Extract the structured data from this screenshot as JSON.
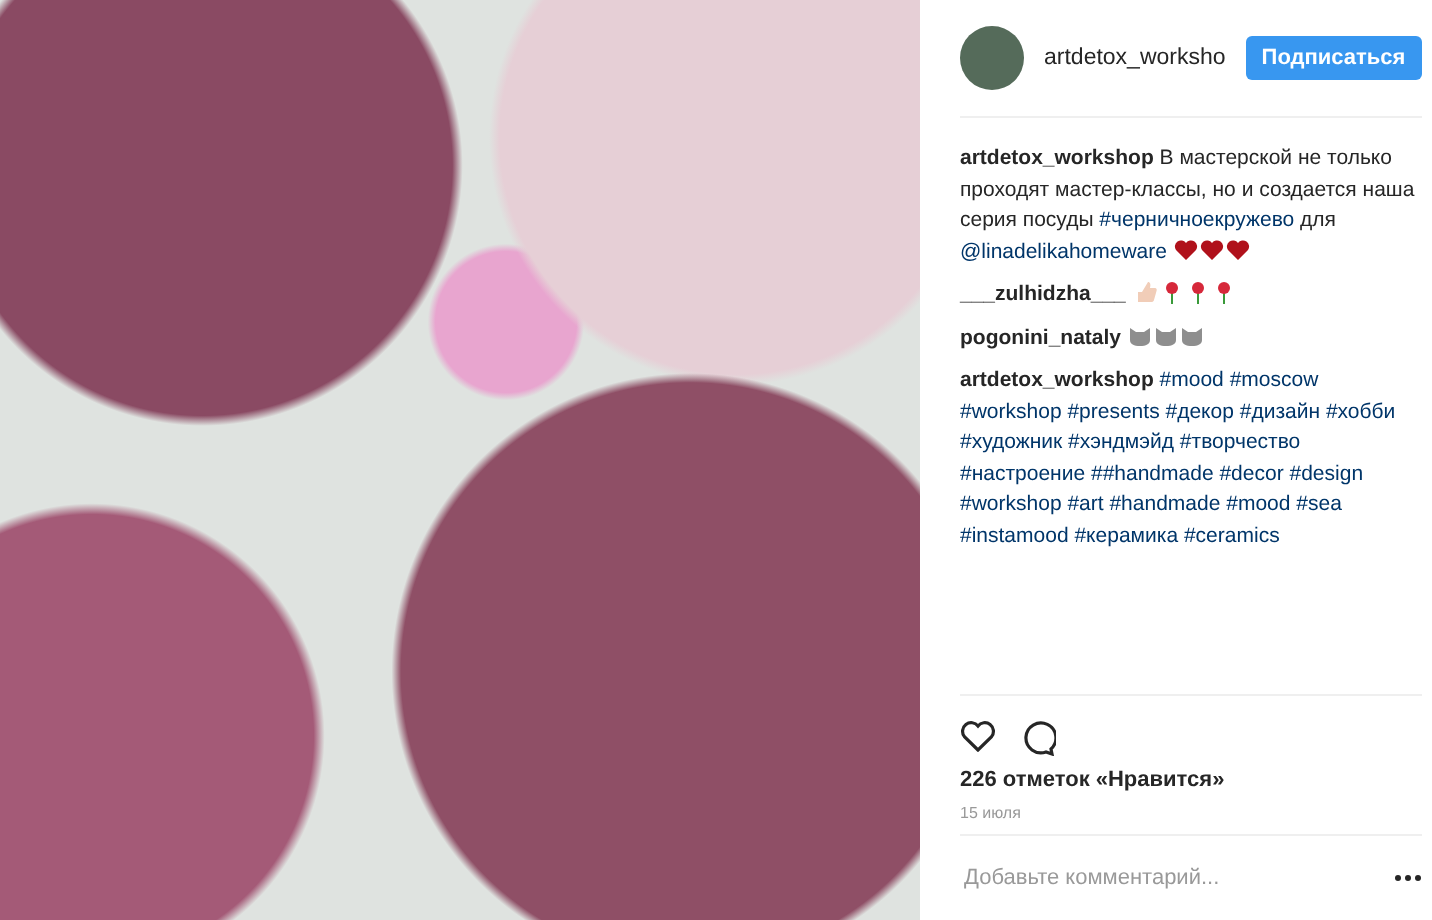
{
  "header": {
    "username": "artdetox_worksho",
    "follow_button": "Подписаться"
  },
  "comments": [
    {
      "username": "artdetox_workshop",
      "parts": [
        {
          "kind": "text",
          "text": "В мастерской не только проходят мастер-классы, но и создается наша серия посуды"
        },
        {
          "kind": "hashtag",
          "text": "#черничноекружево"
        },
        {
          "kind": "text",
          "text": "для"
        },
        {
          "kind": "mention",
          "text": "@linadelikahomeware"
        }
      ],
      "emojis": [
        {
          "kind": "heart"
        },
        {
          "kind": "heart"
        },
        {
          "kind": "heart"
        }
      ]
    },
    {
      "username": "___zulhidzha___",
      "emojis": [
        {
          "kind": "thumb"
        },
        {
          "kind": "rose"
        },
        {
          "kind": "rose"
        },
        {
          "kind": "rose"
        }
      ]
    },
    {
      "username": "pogonini_nataly",
      "emojis": [
        {
          "kind": "cat"
        },
        {
          "kind": "cat"
        },
        {
          "kind": "cat"
        }
      ]
    },
    {
      "username": "artdetox_workshop",
      "parts": [
        {
          "kind": "hashtag",
          "text": "#mood"
        },
        {
          "kind": "hashtag",
          "text": "#moscow"
        },
        {
          "kind": "hashtag",
          "text": "#workshop"
        },
        {
          "kind": "hashtag",
          "text": "#presents"
        },
        {
          "kind": "hashtag",
          "text": "#декор"
        },
        {
          "kind": "hashtag",
          "text": "#дизайн"
        },
        {
          "kind": "hashtag",
          "text": "#хобби"
        },
        {
          "kind": "hashtag",
          "text": "#художник"
        },
        {
          "kind": "hashtag",
          "text": "#хэндмэйд"
        },
        {
          "kind": "hashtag",
          "text": "#творчество"
        },
        {
          "kind": "hashtag",
          "text": "#настроение"
        },
        {
          "kind": "hashtag",
          "text": "##handmade"
        },
        {
          "kind": "hashtag",
          "text": "#decor"
        },
        {
          "kind": "hashtag",
          "text": "#design"
        },
        {
          "kind": "hashtag",
          "text": "#workshop"
        },
        {
          "kind": "hashtag",
          "text": "#art"
        },
        {
          "kind": "hashtag",
          "text": "#handmade"
        },
        {
          "kind": "hashtag",
          "text": "#mood"
        },
        {
          "kind": "hashtag",
          "text": "#sea"
        },
        {
          "kind": "hashtag",
          "text": "#instamood"
        },
        {
          "kind": "hashtag",
          "text": "#керамика"
        },
        {
          "kind": "hashtag",
          "text": "#ceramics"
        }
      ]
    }
  ],
  "likes": "226 отметок «Нравится»",
  "date": "15 июля",
  "comment_field": {
    "placeholder": "Добавьте комментарий..."
  }
}
